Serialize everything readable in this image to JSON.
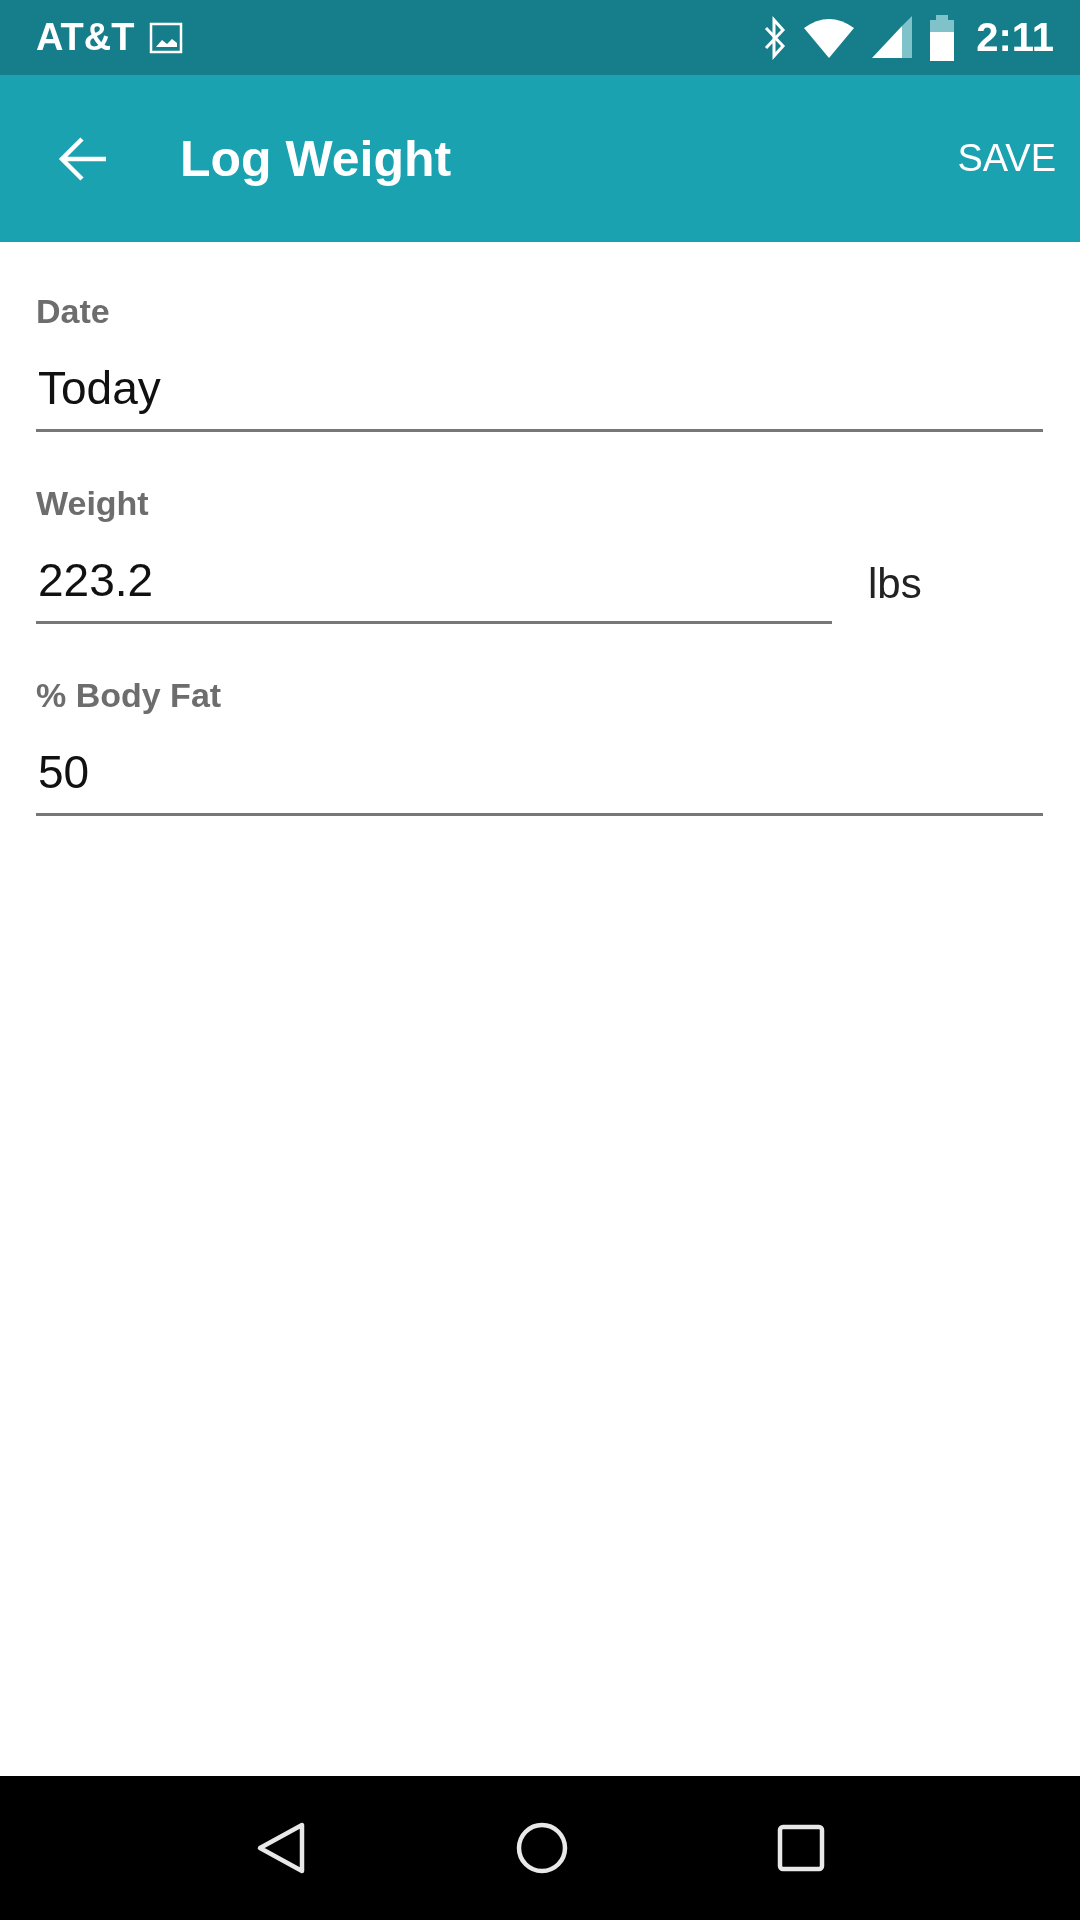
{
  "status_bar": {
    "carrier": "AT&T",
    "time": "2:11"
  },
  "app_bar": {
    "title": "Log Weight",
    "action": "SAVE"
  },
  "fields": [
    {
      "label": "Date",
      "value": "Today"
    },
    {
      "label": "Weight",
      "value": "223.2",
      "unit": "lbs"
    },
    {
      "label": "% Body Fat",
      "value": "50"
    }
  ]
}
